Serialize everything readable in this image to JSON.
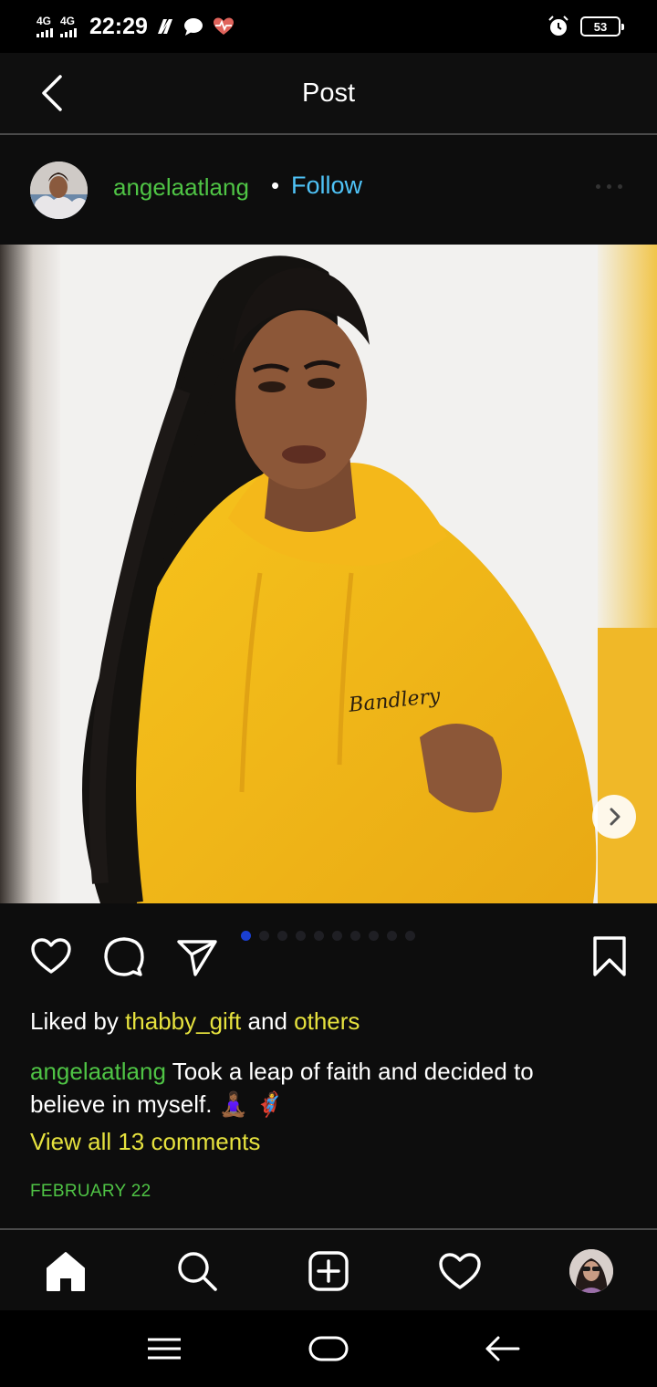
{
  "status_bar": {
    "network_1": "4G",
    "network_2": "4G",
    "time": "22:29",
    "battery": "53",
    "icons": [
      "nfc-icon",
      "chat-bubble-icon",
      "heart-rate-icon",
      "alarm-icon",
      "battery-icon"
    ]
  },
  "header": {
    "title": "Post",
    "back_icon": "chevron-left-icon"
  },
  "post": {
    "username": "angelaatlang",
    "separator": "•",
    "follow_label": "Follow",
    "photo_text": "Bandlery",
    "carousel": {
      "count": 10,
      "active_index": 0
    },
    "likes": {
      "prefix": "Liked by",
      "user": "thabby_gift",
      "middle": "and",
      "others": "others"
    },
    "caption": {
      "username": "angelaatlang",
      "text": "Took a leap of faith and decided to believe in myself. 🧘🏾‍♀️ 🦸"
    },
    "comments_link": "View all 13 comments",
    "date": "FEBRUARY 22"
  },
  "bottom_nav": {
    "items": [
      "home-icon",
      "search-icon",
      "add-post-icon",
      "heart-icon",
      "profile-avatar"
    ]
  },
  "system_nav": {
    "items": [
      "menu-icon",
      "home-pill-icon",
      "back-arrow-icon"
    ]
  },
  "colors": {
    "accent_green": "#4fc445",
    "accent_yellow": "#e6e23e",
    "follow_blue": "#4fc3f7",
    "pager_active": "#1a3fd1",
    "background": "#0d0d0d"
  }
}
